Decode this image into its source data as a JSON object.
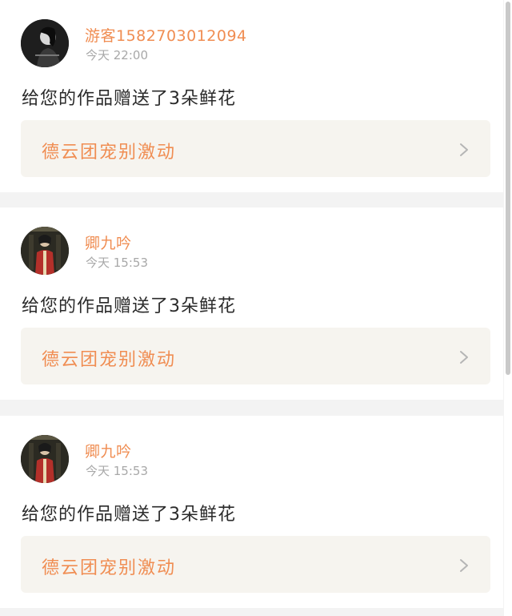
{
  "notifications": [
    {
      "user": "游客1582703012094",
      "time": "今天 22:00",
      "message": "给您的作品赠送了3朵鲜花",
      "work_title": "德云团宠别激动",
      "avatar_icon": "user-photo-dark"
    },
    {
      "user": "卿九吟",
      "time": "今天 15:53",
      "message": "给您的作品赠送了3朵鲜花",
      "work_title": "德云团宠别激动",
      "avatar_icon": "user-photo-red-costume"
    },
    {
      "user": "卿九吟",
      "time": "今天 15:53",
      "message": "给您的作品赠送了3朵鲜花",
      "work_title": "德云团宠别激动",
      "avatar_icon": "user-photo-red-costume"
    }
  ],
  "colors": {
    "accent": "#f08d52",
    "text": "#2a2a2a",
    "muted": "#a8a8a8",
    "link_bg": "#f6f4ef",
    "page_bg": "#f3f3f3"
  }
}
